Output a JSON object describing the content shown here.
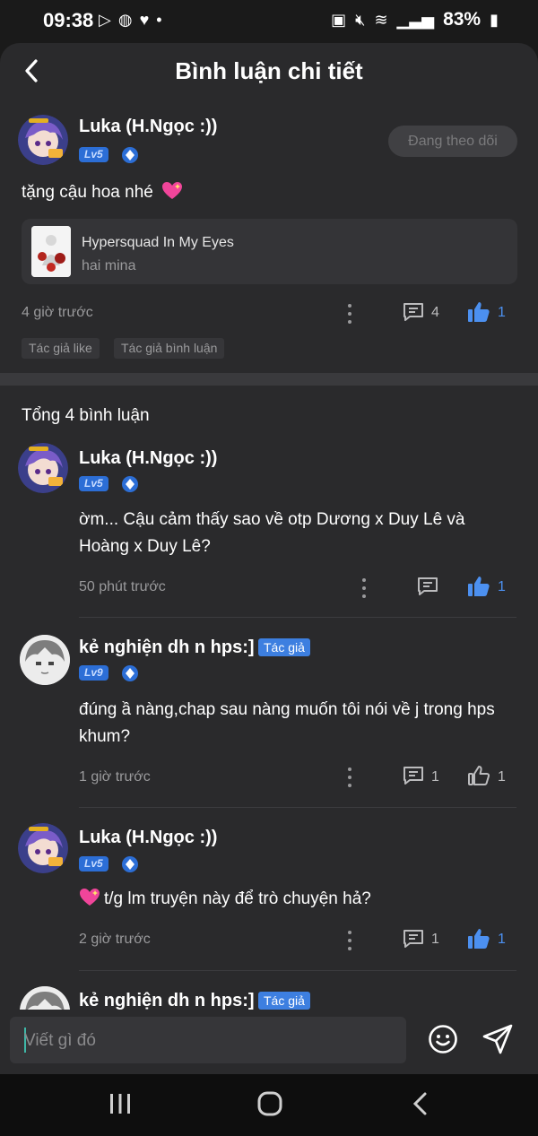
{
  "status_bar": {
    "time": "09:38",
    "battery": "83%"
  },
  "header": {
    "title": "Bình luận chi tiết"
  },
  "post": {
    "author": "Luka (H.Ngọc :))",
    "level": "Lv5",
    "follow_label": "Đang theo dõi",
    "text": "tặng cậu hoa nhé",
    "link": {
      "title": "Hypersquad In My Eyes",
      "subtitle": "hai mina"
    },
    "time": "4 giờ trước",
    "reply_count": "4",
    "like_count": "1",
    "tags": [
      "Tác giả like",
      "Tác giả bình luận"
    ]
  },
  "total_label": "Tổng 4 bình luận",
  "comments": [
    {
      "author": "Luka (H.Ngọc :))",
      "level": "Lv5",
      "text": "ờm... Cậu cảm thấy sao về otp Dương x Duy Lê và Hoàng x Duy Lê?",
      "time": "50 phút trước",
      "reply_count": "",
      "like_count": "1",
      "liked": true
    },
    {
      "author": "kẻ nghiện dh n hps:]",
      "level": "Lv9",
      "author_tag": "Tác giả",
      "text": "đúng ầ nàng,chap sau nàng muốn tôi nói về j trong hps khum?",
      "time": "1 giờ trước",
      "reply_count": "1",
      "like_count": "1",
      "liked": false
    },
    {
      "author": "Luka (H.Ngọc :))",
      "level": "Lv5",
      "text": "t/g lm truyện này để trò chuyện hả?",
      "time": "2 giờ trước",
      "reply_count": "1",
      "like_count": "1",
      "liked": true
    },
    {
      "author": "kẻ nghiện dh n hps:]",
      "author_tag": "Tác giả"
    }
  ],
  "input": {
    "placeholder": "Viết gì đó"
  },
  "colors": {
    "accent": "#4c90f0",
    "background": "#2a2a2c"
  }
}
